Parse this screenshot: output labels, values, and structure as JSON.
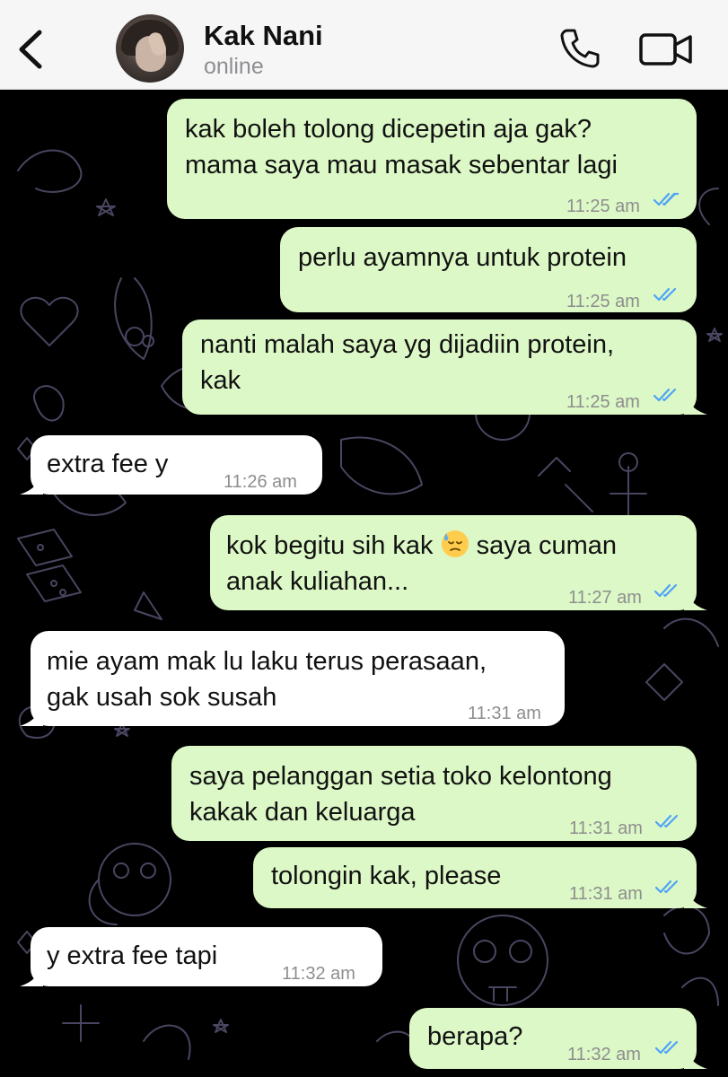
{
  "contact": {
    "name": "Kak Nani",
    "status": "online"
  },
  "messages": [
    {
      "dir": "out",
      "text": "kak boleh tolong dicepetin aja gak?\nmama saya mau masak sebentar lagi",
      "time": "11:25 am"
    },
    {
      "dir": "out",
      "text": "perlu ayamnya untuk protein",
      "time": "11:25 am"
    },
    {
      "dir": "out",
      "text": "nanti malah saya yg dijadiin protein,\nkak",
      "time": "11:25 am"
    },
    {
      "dir": "in",
      "text": "extra fee y",
      "time": "11:26 am"
    },
    {
      "dir": "out",
      "text_before_emoji": "kok begitu sih kak",
      "emoji": "downcast-face-with-sweat-icon",
      "text_after_emoji": "saya cuman\nanak kuliahan...",
      "time": "11:27 am"
    },
    {
      "dir": "in",
      "text": "mie ayam mak lu laku terus perasaan,\ngak usah sok susah",
      "time": "11:31 am"
    },
    {
      "dir": "out",
      "text": "saya pelanggan setia toko kelontong\nkakak dan keluarga",
      "time": "11:31 am"
    },
    {
      "dir": "out",
      "text": "tolongin kak, please",
      "time": "11:31 am"
    },
    {
      "dir": "in",
      "text": "y extra fee tapi",
      "time": "11:32 am"
    },
    {
      "dir": "out",
      "text": "berapa?",
      "time": "11:32 am"
    }
  ],
  "icons": {
    "back": "chevron-left-icon",
    "call": "phone-icon",
    "video": "video-camera-icon",
    "read_receipt": "double-check-icon"
  },
  "colors": {
    "header_bg": "#f6f6f6",
    "chat_bg": "#000000",
    "outgoing_bubble": "#dcf8c6",
    "incoming_bubble": "#ffffff",
    "read_ticks": "#4fa3f7",
    "timestamp": "#8e8e8e"
  }
}
